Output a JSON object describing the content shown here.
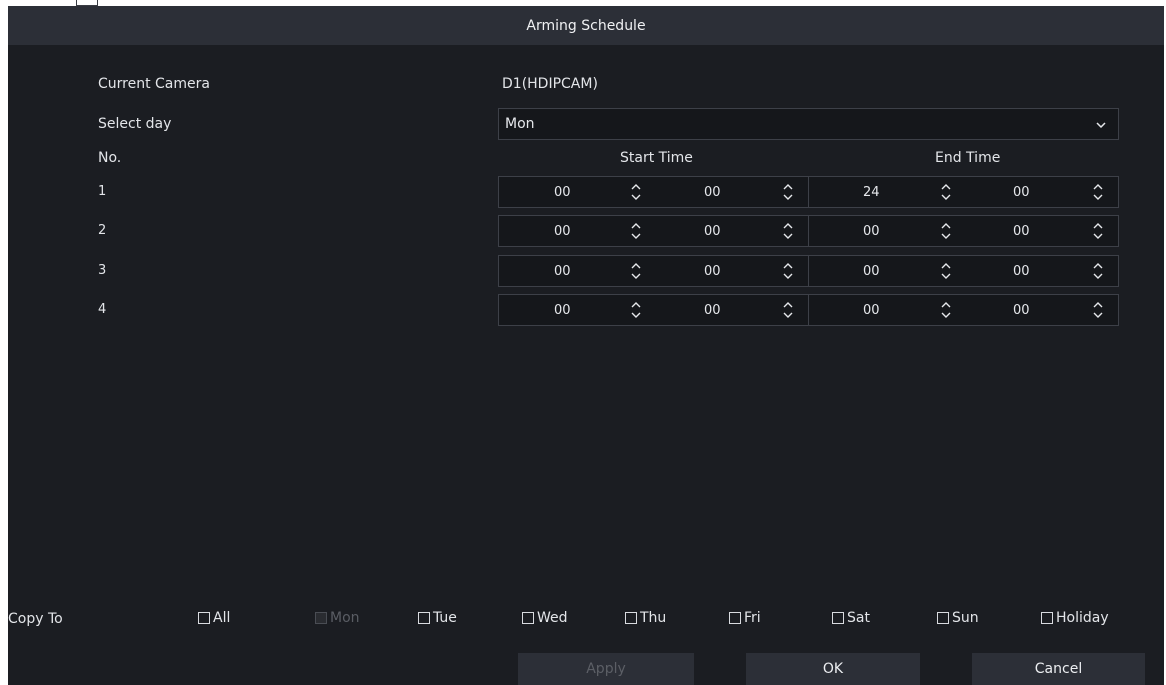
{
  "dialog": {
    "title": "Arming Schedule"
  },
  "form": {
    "current_camera_label": "Current Camera",
    "current_camera_value": "D1(HDIPCAM)",
    "select_day_label": "Select day",
    "select_day_value": "Mon",
    "no_label": "No.",
    "start_time_label": "Start Time",
    "end_time_label": "End Time"
  },
  "rows": [
    {
      "no": "1",
      "start_h": "00",
      "start_m": "00",
      "end_h": "24",
      "end_m": "00"
    },
    {
      "no": "2",
      "start_h": "00",
      "start_m": "00",
      "end_h": "00",
      "end_m": "00"
    },
    {
      "no": "3",
      "start_h": "00",
      "start_m": "00",
      "end_h": "00",
      "end_m": "00"
    },
    {
      "no": "4",
      "start_h": "00",
      "start_m": "00",
      "end_h": "00",
      "end_m": "00"
    }
  ],
  "copy_to": {
    "label": "Copy To",
    "options": [
      {
        "label": "All",
        "checked": false,
        "disabled": false
      },
      {
        "label": "Mon",
        "checked": false,
        "disabled": true
      },
      {
        "label": "Tue",
        "checked": false,
        "disabled": false
      },
      {
        "label": "Wed",
        "checked": false,
        "disabled": false
      },
      {
        "label": "Thu",
        "checked": false,
        "disabled": false
      },
      {
        "label": "Fri",
        "checked": false,
        "disabled": false
      },
      {
        "label": "Sat",
        "checked": false,
        "disabled": false
      },
      {
        "label": "Sun",
        "checked": false,
        "disabled": false
      },
      {
        "label": "Holiday",
        "checked": false,
        "disabled": false
      }
    ]
  },
  "buttons": {
    "apply": "Apply",
    "ok": "OK",
    "cancel": "Cancel"
  },
  "icons": {
    "dropdown": "chevron-down-icon",
    "spinner": "spinner-up-down-icon"
  },
  "colors": {
    "background": "#1b1d22",
    "titlebar": "#2c2f37",
    "field": "#15171b",
    "border": "#3d4048",
    "text": "#e3e5e9",
    "disabled_text": "#5a5d64"
  }
}
